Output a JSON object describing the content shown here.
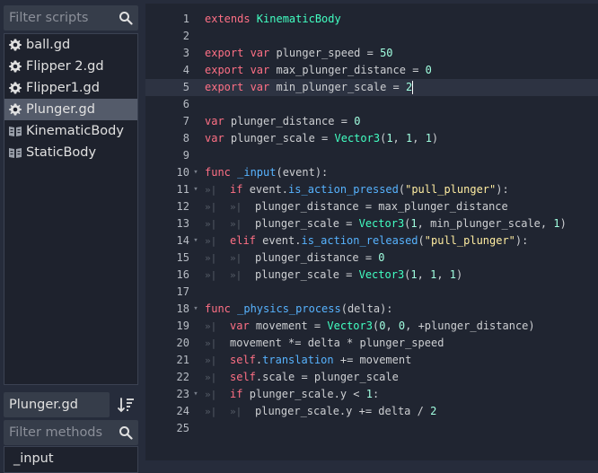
{
  "sidebar": {
    "filter_scripts_placeholder": "Filter scripts",
    "scripts": [
      {
        "name": "ball.gd",
        "icon": "gear-icon",
        "selected": false
      },
      {
        "name": "Flipper 2.gd",
        "icon": "gear-icon",
        "selected": false
      },
      {
        "name": "Flipper1.gd",
        "icon": "gear-icon",
        "selected": false
      },
      {
        "name": "Plunger.gd",
        "icon": "gear-icon",
        "selected": true
      },
      {
        "name": "KinematicBody",
        "icon": "class-doc-icon",
        "selected": false
      },
      {
        "name": "StaticBody",
        "icon": "class-doc-icon",
        "selected": false
      }
    ],
    "current_script": "Plunger.gd",
    "filter_methods_placeholder": "Filter methods",
    "methods": [
      "_input"
    ]
  },
  "editor": {
    "current_line": 5,
    "colors": {
      "keyword": "#ff7085",
      "type": "#42ffc2",
      "function": "#57b3ff",
      "number": "#a1ffe0",
      "string": "#ffeda1",
      "text": "#cdcfd2"
    },
    "lines": [
      {
        "n": "1",
        "fold": "",
        "indent": 0,
        "tokens": [
          [
            "kw",
            "extends "
          ],
          [
            "ty",
            "KinematicBody"
          ]
        ]
      },
      {
        "n": "2",
        "fold": "",
        "indent": 0,
        "tokens": []
      },
      {
        "n": "3",
        "fold": "",
        "indent": 0,
        "tokens": [
          [
            "kw",
            "export "
          ],
          [
            "kw",
            "var "
          ],
          [
            "t",
            "plunger_speed = "
          ],
          [
            "num",
            "50"
          ]
        ]
      },
      {
        "n": "4",
        "fold": "",
        "indent": 0,
        "tokens": [
          [
            "kw",
            "export "
          ],
          [
            "kw",
            "var "
          ],
          [
            "t",
            "max_plunger_distance = "
          ],
          [
            "num",
            "0"
          ]
        ]
      },
      {
        "n": "5",
        "fold": "",
        "indent": 0,
        "tokens": [
          [
            "kw",
            "export "
          ],
          [
            "kw",
            "var "
          ],
          [
            "t",
            "min_plunger_scale = "
          ],
          [
            "num",
            "2"
          ]
        ]
      },
      {
        "n": "6",
        "fold": "",
        "indent": 0,
        "tokens": []
      },
      {
        "n": "7",
        "fold": "",
        "indent": 0,
        "tokens": [
          [
            "kw",
            "var "
          ],
          [
            "t",
            "plunger_distance = "
          ],
          [
            "num",
            "0"
          ]
        ]
      },
      {
        "n": "8",
        "fold": "",
        "indent": 0,
        "tokens": [
          [
            "kw",
            "var "
          ],
          [
            "t",
            "plunger_scale = "
          ],
          [
            "ty",
            "Vector3"
          ],
          [
            "t",
            "("
          ],
          [
            "num",
            "1"
          ],
          [
            "t",
            ", "
          ],
          [
            "num",
            "1"
          ],
          [
            "t",
            ", "
          ],
          [
            "num",
            "1"
          ],
          [
            "t",
            ")"
          ]
        ]
      },
      {
        "n": "9",
        "fold": "",
        "indent": 0,
        "tokens": []
      },
      {
        "n": "10",
        "fold": "v",
        "indent": 0,
        "tokens": [
          [
            "kw",
            "func "
          ],
          [
            "fn",
            "_input"
          ],
          [
            "t",
            "(event):"
          ]
        ]
      },
      {
        "n": "11",
        "fold": "v",
        "indent": 1,
        "tokens": [
          [
            "kw",
            "if "
          ],
          [
            "t",
            "event."
          ],
          [
            "fn",
            "is_action_pressed"
          ],
          [
            "t",
            "("
          ],
          [
            "str",
            "\"pull_plunger\""
          ],
          [
            "t",
            "):"
          ]
        ]
      },
      {
        "n": "12",
        "fold": "",
        "indent": 2,
        "tokens": [
          [
            "t",
            "plunger_distance = max_plunger_distance"
          ]
        ]
      },
      {
        "n": "13",
        "fold": "",
        "indent": 2,
        "tokens": [
          [
            "t",
            "plunger_scale = "
          ],
          [
            "ty",
            "Vector3"
          ],
          [
            "t",
            "("
          ],
          [
            "num",
            "1"
          ],
          [
            "t",
            ", min_plunger_scale, "
          ],
          [
            "num",
            "1"
          ],
          [
            "t",
            ")"
          ]
        ]
      },
      {
        "n": "14",
        "fold": "v",
        "indent": 1,
        "tokens": [
          [
            "kw",
            "elif "
          ],
          [
            "t",
            "event."
          ],
          [
            "fn",
            "is_action_released"
          ],
          [
            "t",
            "("
          ],
          [
            "str",
            "\"pull_plunger\""
          ],
          [
            "t",
            "):"
          ]
        ]
      },
      {
        "n": "15",
        "fold": "",
        "indent": 2,
        "tokens": [
          [
            "t",
            "plunger_distance = "
          ],
          [
            "num",
            "0"
          ]
        ]
      },
      {
        "n": "16",
        "fold": "",
        "indent": 2,
        "tokens": [
          [
            "t",
            "plunger_scale = "
          ],
          [
            "ty",
            "Vector3"
          ],
          [
            "t",
            "("
          ],
          [
            "num",
            "1"
          ],
          [
            "t",
            ", "
          ],
          [
            "num",
            "1"
          ],
          [
            "t",
            ", "
          ],
          [
            "num",
            "1"
          ],
          [
            "t",
            ")"
          ]
        ]
      },
      {
        "n": "17",
        "fold": "",
        "indent": 0,
        "tokens": []
      },
      {
        "n": "18",
        "fold": "v",
        "indent": 0,
        "tokens": [
          [
            "kw",
            "func "
          ],
          [
            "fn",
            "_physics_process"
          ],
          [
            "t",
            "(delta):"
          ]
        ]
      },
      {
        "n": "19",
        "fold": "",
        "indent": 1,
        "tokens": [
          [
            "kw",
            "var "
          ],
          [
            "t",
            "movement = "
          ],
          [
            "ty",
            "Vector3"
          ],
          [
            "t",
            "("
          ],
          [
            "num",
            "0"
          ],
          [
            "t",
            ", "
          ],
          [
            "num",
            "0"
          ],
          [
            "t",
            ", +plunger_distance)"
          ]
        ]
      },
      {
        "n": "20",
        "fold": "",
        "indent": 1,
        "tokens": [
          [
            "t",
            "movement *= delta * plunger_speed"
          ]
        ]
      },
      {
        "n": "21",
        "fold": "",
        "indent": 1,
        "tokens": [
          [
            "kw",
            "self"
          ],
          [
            "t",
            "."
          ],
          [
            "fn",
            "translation"
          ],
          [
            "t",
            " += movement"
          ]
        ]
      },
      {
        "n": "22",
        "fold": "",
        "indent": 1,
        "tokens": [
          [
            "kw",
            "self"
          ],
          [
            "t",
            ".scale = plunger_scale"
          ]
        ]
      },
      {
        "n": "23",
        "fold": "v",
        "indent": 1,
        "tokens": [
          [
            "kw",
            "if "
          ],
          [
            "t",
            "plunger_scale.y < "
          ],
          [
            "num",
            "1"
          ],
          [
            "t",
            ":"
          ]
        ]
      },
      {
        "n": "24",
        "fold": "",
        "indent": 2,
        "tokens": [
          [
            "t",
            "plunger_scale.y += delta / "
          ],
          [
            "num",
            "2"
          ]
        ]
      },
      {
        "n": "25",
        "fold": "",
        "indent": 0,
        "tokens": []
      }
    ]
  }
}
